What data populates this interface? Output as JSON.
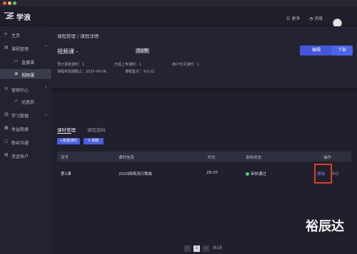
{
  "window": {
    "controls": [
      {
        "name": "close",
        "color": "#ec5f56"
      },
      {
        "name": "minimize",
        "color": "#f4be4f"
      },
      {
        "name": "maximize",
        "color": "#60c454"
      }
    ]
  },
  "topbar": {
    "app_name": "学浪",
    "more_label": "更多",
    "messages_label": "消息"
  },
  "sidebar": {
    "items": [
      {
        "label": "主页",
        "icon": "home-icon",
        "glyph": "⌂"
      },
      {
        "label": "课程管理",
        "icon": "book-icon",
        "glyph": "▤",
        "chev": "⌃"
      },
      {
        "label": "直播课",
        "icon": "video-icon",
        "glyph": "▭"
      },
      {
        "label": "视频课",
        "icon": "play-box-icon",
        "glyph": "▣"
      },
      {
        "label": "营销中心",
        "icon": "marketing-icon",
        "glyph": "◎",
        "chev": "⌃"
      },
      {
        "label": "优惠券",
        "icon": "coupon-icon",
        "glyph": "▱"
      },
      {
        "label": "学习数据",
        "icon": "chart-icon",
        "glyph": "▥",
        "chev": "⌄"
      },
      {
        "label": "收益数据",
        "icon": "income-icon",
        "glyph": "▦"
      },
      {
        "label": "粉丝沟通",
        "icon": "chat-icon",
        "glyph": "▢"
      },
      {
        "label": "资金账户",
        "icon": "wallet-icon",
        "glyph": "▤"
      }
    ]
  },
  "header": {
    "breadcrumb": "课程管理 / 课程详情",
    "course_title": "视频课 -",
    "tag": "已上架",
    "edit_button": "编辑",
    "publish_button": "下架"
  },
  "meta": {
    "expected_lessons": "预计更新课时：1",
    "uploaded_lessons": "已经上传课时：1",
    "visible_lessons": "用户可见课时：1",
    "valid_until": "课程有效期截止：2030-06-06",
    "price": "课程售价：￥0.02"
  },
  "tabs": [
    {
      "label": "课时管理",
      "active": true
    },
    {
      "label": "课程资料",
      "active": false
    }
  ],
  "actions": {
    "new_lesson": "+新建课时",
    "refresh": "↻ 刷新"
  },
  "table": {
    "columns": [
      "序号",
      "课时信息",
      "时长",
      "审核状态",
      "操作"
    ],
    "rows": [
      {
        "index": "第1课",
        "info": "2020网络流行歌曲",
        "duration": "28:20",
        "status": "审核通过",
        "status_color": "#4bd06a",
        "edit": "编辑",
        "move": "移动"
      }
    ]
  },
  "pagination": {
    "prev": "‹",
    "current": "1",
    "next": "›",
    "total": "共1页"
  },
  "watermark": "裕辰达"
}
